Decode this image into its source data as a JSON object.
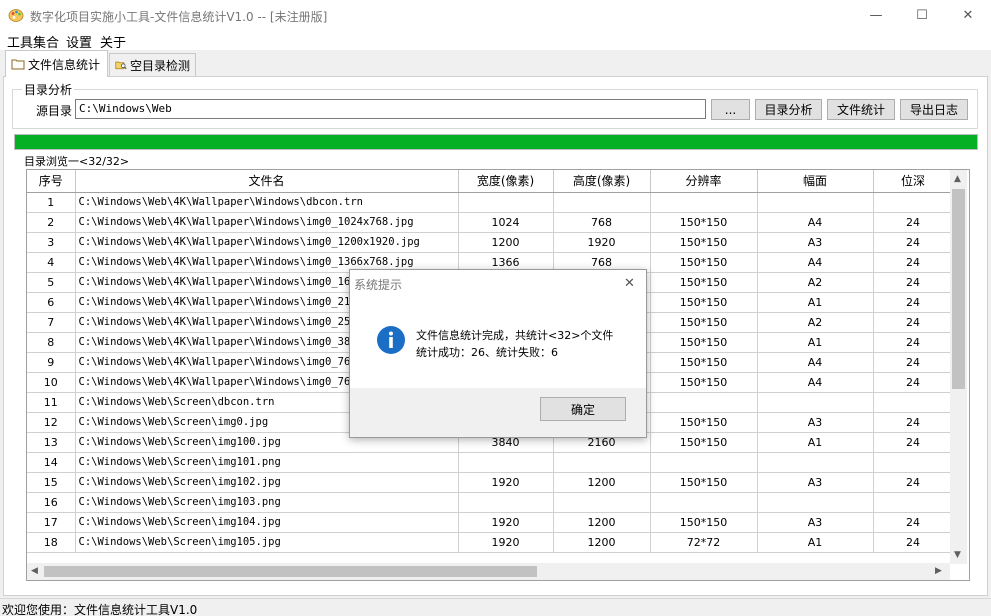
{
  "window": {
    "title": "数字化项目实施小工具-文件信息统计V1.0 -- [未注册版]",
    "minimize_glyph": "—",
    "maximize_glyph": "☐",
    "close_glyph": "✕"
  },
  "menu": [
    "工具集合",
    "设置",
    "关于"
  ],
  "tabs": [
    {
      "label": "文件信息统计",
      "icon": "folder-icon",
      "active": true
    },
    {
      "label": "空目录检测",
      "icon": "folder-search-icon",
      "active": false
    }
  ],
  "analysis": {
    "group_title": "目录分析",
    "source_label": "源目录",
    "source_value": "C:\\Windows\\Web",
    "browse_label": "...",
    "buttons": [
      "目录分析",
      "文件统计",
      "导出日志"
    ]
  },
  "progress": {
    "fraction": 1.0,
    "color": "#06b025"
  },
  "browse": {
    "label": "目录浏览一<32/32>"
  },
  "table": {
    "columns": [
      "序号",
      "文件名",
      "宽度(像素)",
      "高度(像素)",
      "分辨率",
      "幅面",
      "位深"
    ],
    "rows": [
      [
        "1",
        "C:\\Windows\\Web\\4K\\Wallpaper\\Windows\\dbcon.trn",
        "",
        "",
        "",
        "",
        ""
      ],
      [
        "2",
        "C:\\Windows\\Web\\4K\\Wallpaper\\Windows\\img0_1024x768.jpg",
        "1024",
        "768",
        "150*150",
        "A4",
        "24"
      ],
      [
        "3",
        "C:\\Windows\\Web\\4K\\Wallpaper\\Windows\\img0_1200x1920.jpg",
        "1200",
        "1920",
        "150*150",
        "A3",
        "24"
      ],
      [
        "4",
        "C:\\Windows\\Web\\4K\\Wallpaper\\Windows\\img0_1366x768.jpg",
        "1366",
        "768",
        "150*150",
        "A4",
        "24"
      ],
      [
        "5",
        "C:\\Windows\\Web\\4K\\Wallpaper\\Windows\\img0_1600x",
        "",
        "",
        "150*150",
        "A2",
        "24"
      ],
      [
        "6",
        "C:\\Windows\\Web\\4K\\Wallpaper\\Windows\\img0_2160x",
        "",
        "",
        "150*150",
        "A1",
        "24"
      ],
      [
        "7",
        "C:\\Windows\\Web\\4K\\Wallpaper\\Windows\\img0_2560x",
        "",
        "",
        "150*150",
        "A2",
        "24"
      ],
      [
        "8",
        "C:\\Windows\\Web\\4K\\Wallpaper\\Windows\\img0_3840x",
        "",
        "",
        "150*150",
        "A1",
        "24"
      ],
      [
        "9",
        "C:\\Windows\\Web\\4K\\Wallpaper\\Windows\\img0_768x1",
        "",
        "",
        "150*150",
        "A4",
        "24"
      ],
      [
        "10",
        "C:\\Windows\\Web\\4K\\Wallpaper\\Windows\\img0_768x1",
        "",
        "",
        "150*150",
        "A4",
        "24"
      ],
      [
        "11",
        "C:\\Windows\\Web\\Screen\\dbcon.trn",
        "",
        "",
        "",
        "",
        ""
      ],
      [
        "12",
        "C:\\Windows\\Web\\Screen\\img0.jpg",
        "",
        "",
        "150*150",
        "A3",
        "24"
      ],
      [
        "13",
        "C:\\Windows\\Web\\Screen\\img100.jpg",
        "3840",
        "2160",
        "150*150",
        "A1",
        "24"
      ],
      [
        "14",
        "C:\\Windows\\Web\\Screen\\img101.png",
        "",
        "",
        "",
        "",
        ""
      ],
      [
        "15",
        "C:\\Windows\\Web\\Screen\\img102.jpg",
        "1920",
        "1200",
        "150*150",
        "A3",
        "24"
      ],
      [
        "16",
        "C:\\Windows\\Web\\Screen\\img103.png",
        "",
        "",
        "",
        "",
        ""
      ],
      [
        "17",
        "C:\\Windows\\Web\\Screen\\img104.jpg",
        "1920",
        "1200",
        "150*150",
        "A3",
        "24"
      ],
      [
        "18",
        "C:\\Windows\\Web\\Screen\\img105.jpg",
        "1920",
        "1200",
        "72*72",
        "A1",
        "24"
      ]
    ]
  },
  "dialog": {
    "title": "系统提示",
    "close_glyph": "✕",
    "line1": "文件信息统计完成，共统计<32>个文件",
    "line2": "统计成功：26、统计失败：6",
    "ok_label": "确定",
    "icon": "info-icon"
  },
  "status": {
    "text": "欢迎您使用：文件信息统计工具V1.0"
  }
}
